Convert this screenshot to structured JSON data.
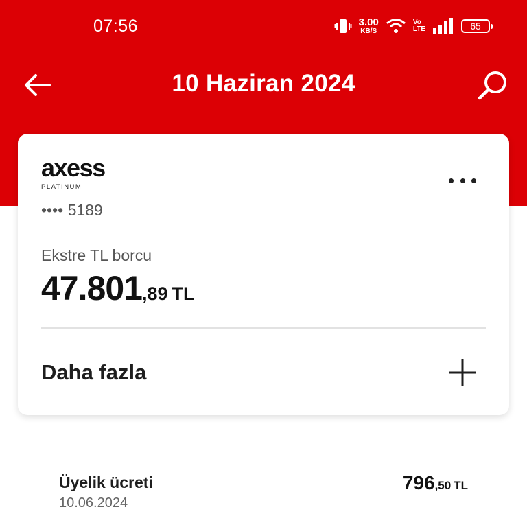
{
  "status_bar": {
    "time": "07:56",
    "net_speed_value": "3.00",
    "net_speed_unit": "KB/S",
    "volte_top": "Vo",
    "volte_bottom": "LTE",
    "battery": "65",
    "icons": [
      "vibrate-icon",
      "wifi-icon",
      "signal-icon",
      "battery-icon"
    ]
  },
  "app_bar": {
    "title": "10 Haziran 2024",
    "back_icon": "arrow-left-icon",
    "search_icon": "search-icon"
  },
  "card": {
    "brand": "axess",
    "tier": "PLATINUM",
    "number_mask": "•••• 5189",
    "statement_label": "Ekstre TL borcu",
    "amount_integer": "47.801",
    "amount_decimal": ",89",
    "amount_currency": "TL",
    "more_label": "Daha fazla",
    "more_icon": "plus-icon",
    "options_icon": "more-horizontal-icon"
  },
  "transactions": [
    {
      "title": "Üyelik ücreti",
      "date": "10.06.2024",
      "amount_integer": "796",
      "amount_decimal": ",50",
      "currency": "TL"
    }
  ],
  "colors": {
    "brand_red": "#dc0005",
    "text_dark": "#1e1e1e",
    "text_muted": "#555555"
  }
}
